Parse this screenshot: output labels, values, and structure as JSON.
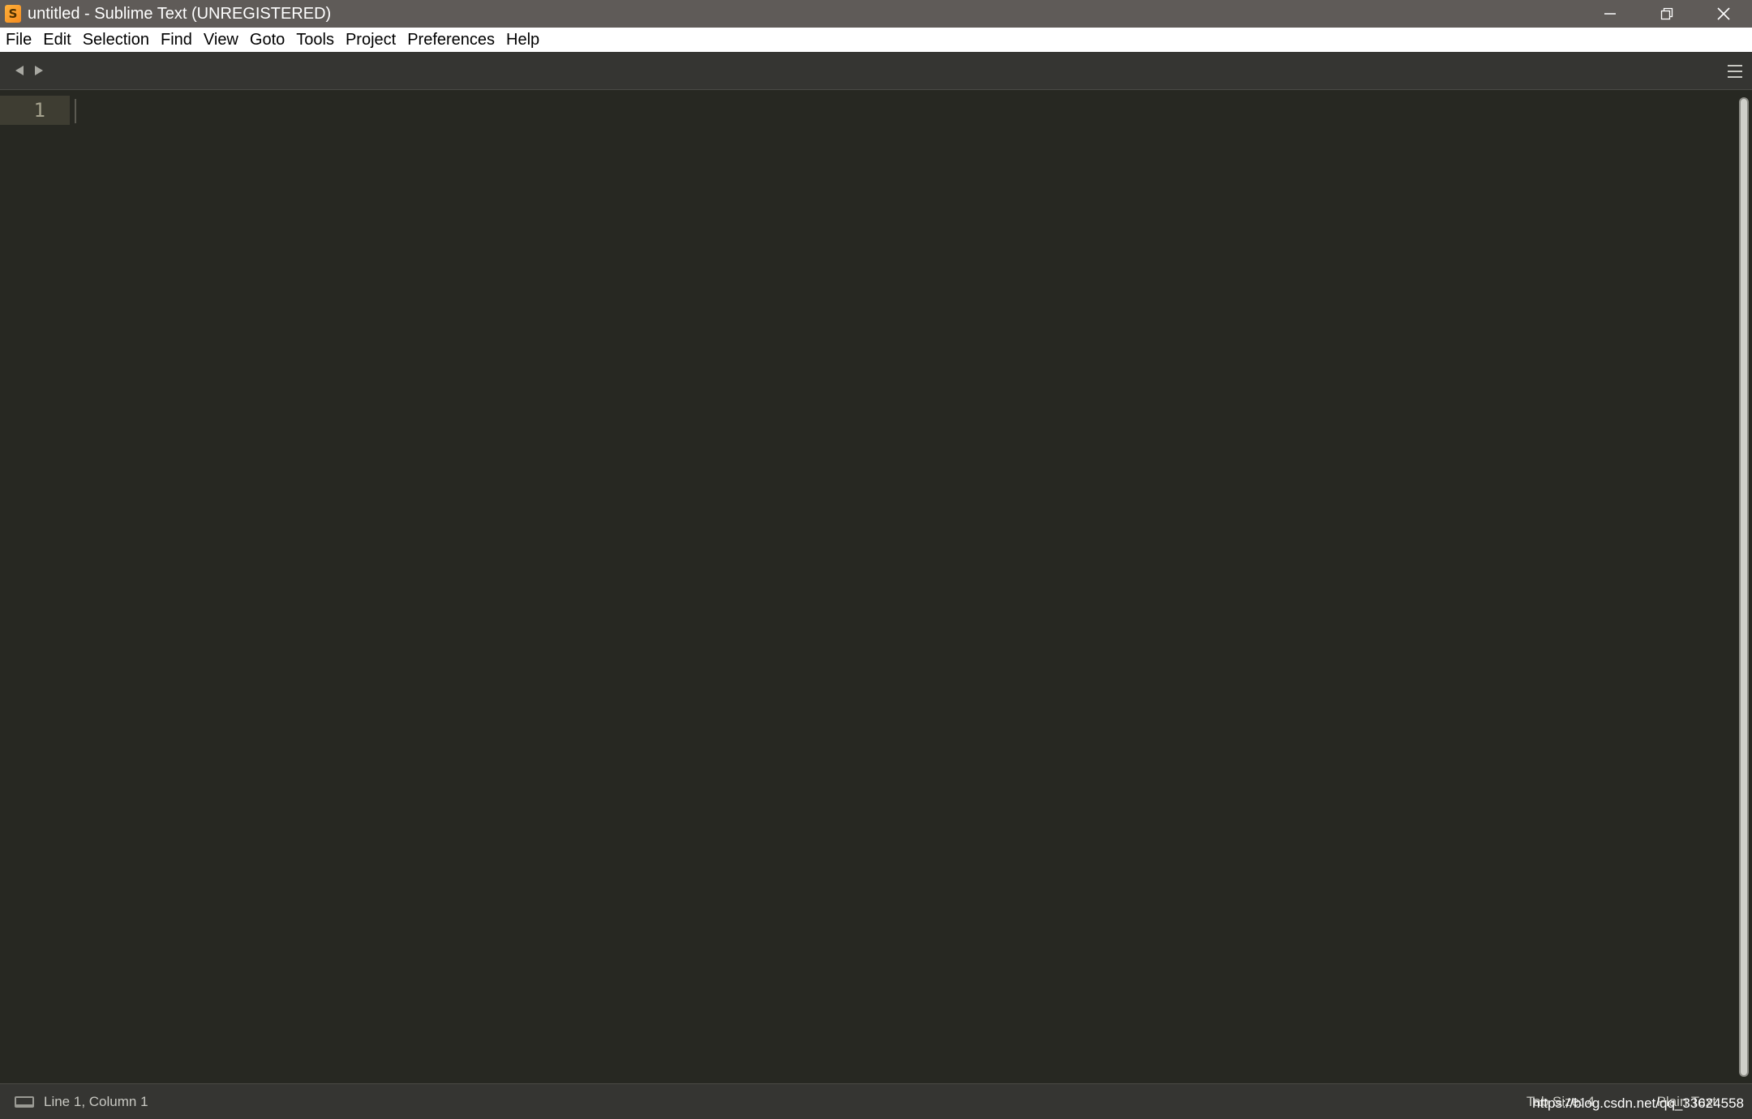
{
  "window": {
    "title": "untitled - Sublime Text (UNREGISTERED)",
    "logo_letter": "S"
  },
  "menu": {
    "items": [
      {
        "label": "File"
      },
      {
        "label": "Edit"
      },
      {
        "label": "Selection"
      },
      {
        "label": "Find"
      },
      {
        "label": "View"
      },
      {
        "label": "Goto"
      },
      {
        "label": "Tools"
      },
      {
        "label": "Project"
      },
      {
        "label": "Preferences"
      },
      {
        "label": "Help"
      }
    ]
  },
  "editor": {
    "line_numbers": [
      "1"
    ]
  },
  "status": {
    "position": "Line 1, Column 1",
    "tab_size": "Tab Size: 4",
    "syntax": "Plain Text",
    "watermark": "https://blog.csdn.net/qq_33624558"
  },
  "colors": {
    "titlebar": "#5f5b58",
    "editor_bg": "#272822",
    "line_highlight": "#3e3d32",
    "statusbar": "#353532",
    "logo": "#f48b1f"
  },
  "icons": {
    "logo": "sublime-logo-icon",
    "minimize": "minimize-icon",
    "maximize": "restore-icon",
    "close": "close-icon",
    "tab_prev": "triangle-left-icon",
    "tab_next": "triangle-right-icon",
    "tab_menu": "hamburger-icon",
    "console": "console-icon"
  }
}
